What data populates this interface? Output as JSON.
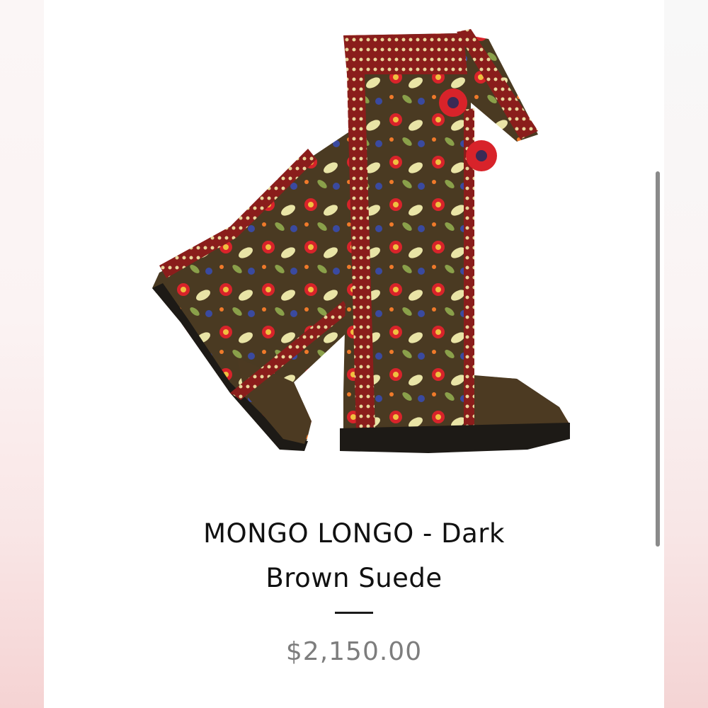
{
  "product": {
    "title_line1": "MONGO LONGO - Dark",
    "title_line2": "Brown Suede",
    "price": "$2,150.00",
    "image": "embroidered-knee-high-boots"
  },
  "colors": {
    "suede": "#4a3a22",
    "embroidery_red": "#d8232a",
    "embroidery_cream": "#f0e6a8",
    "embroidery_green": "#8aa04a",
    "price_text": "#7d7d7d",
    "scrollbar": "#8a8a8a"
  }
}
